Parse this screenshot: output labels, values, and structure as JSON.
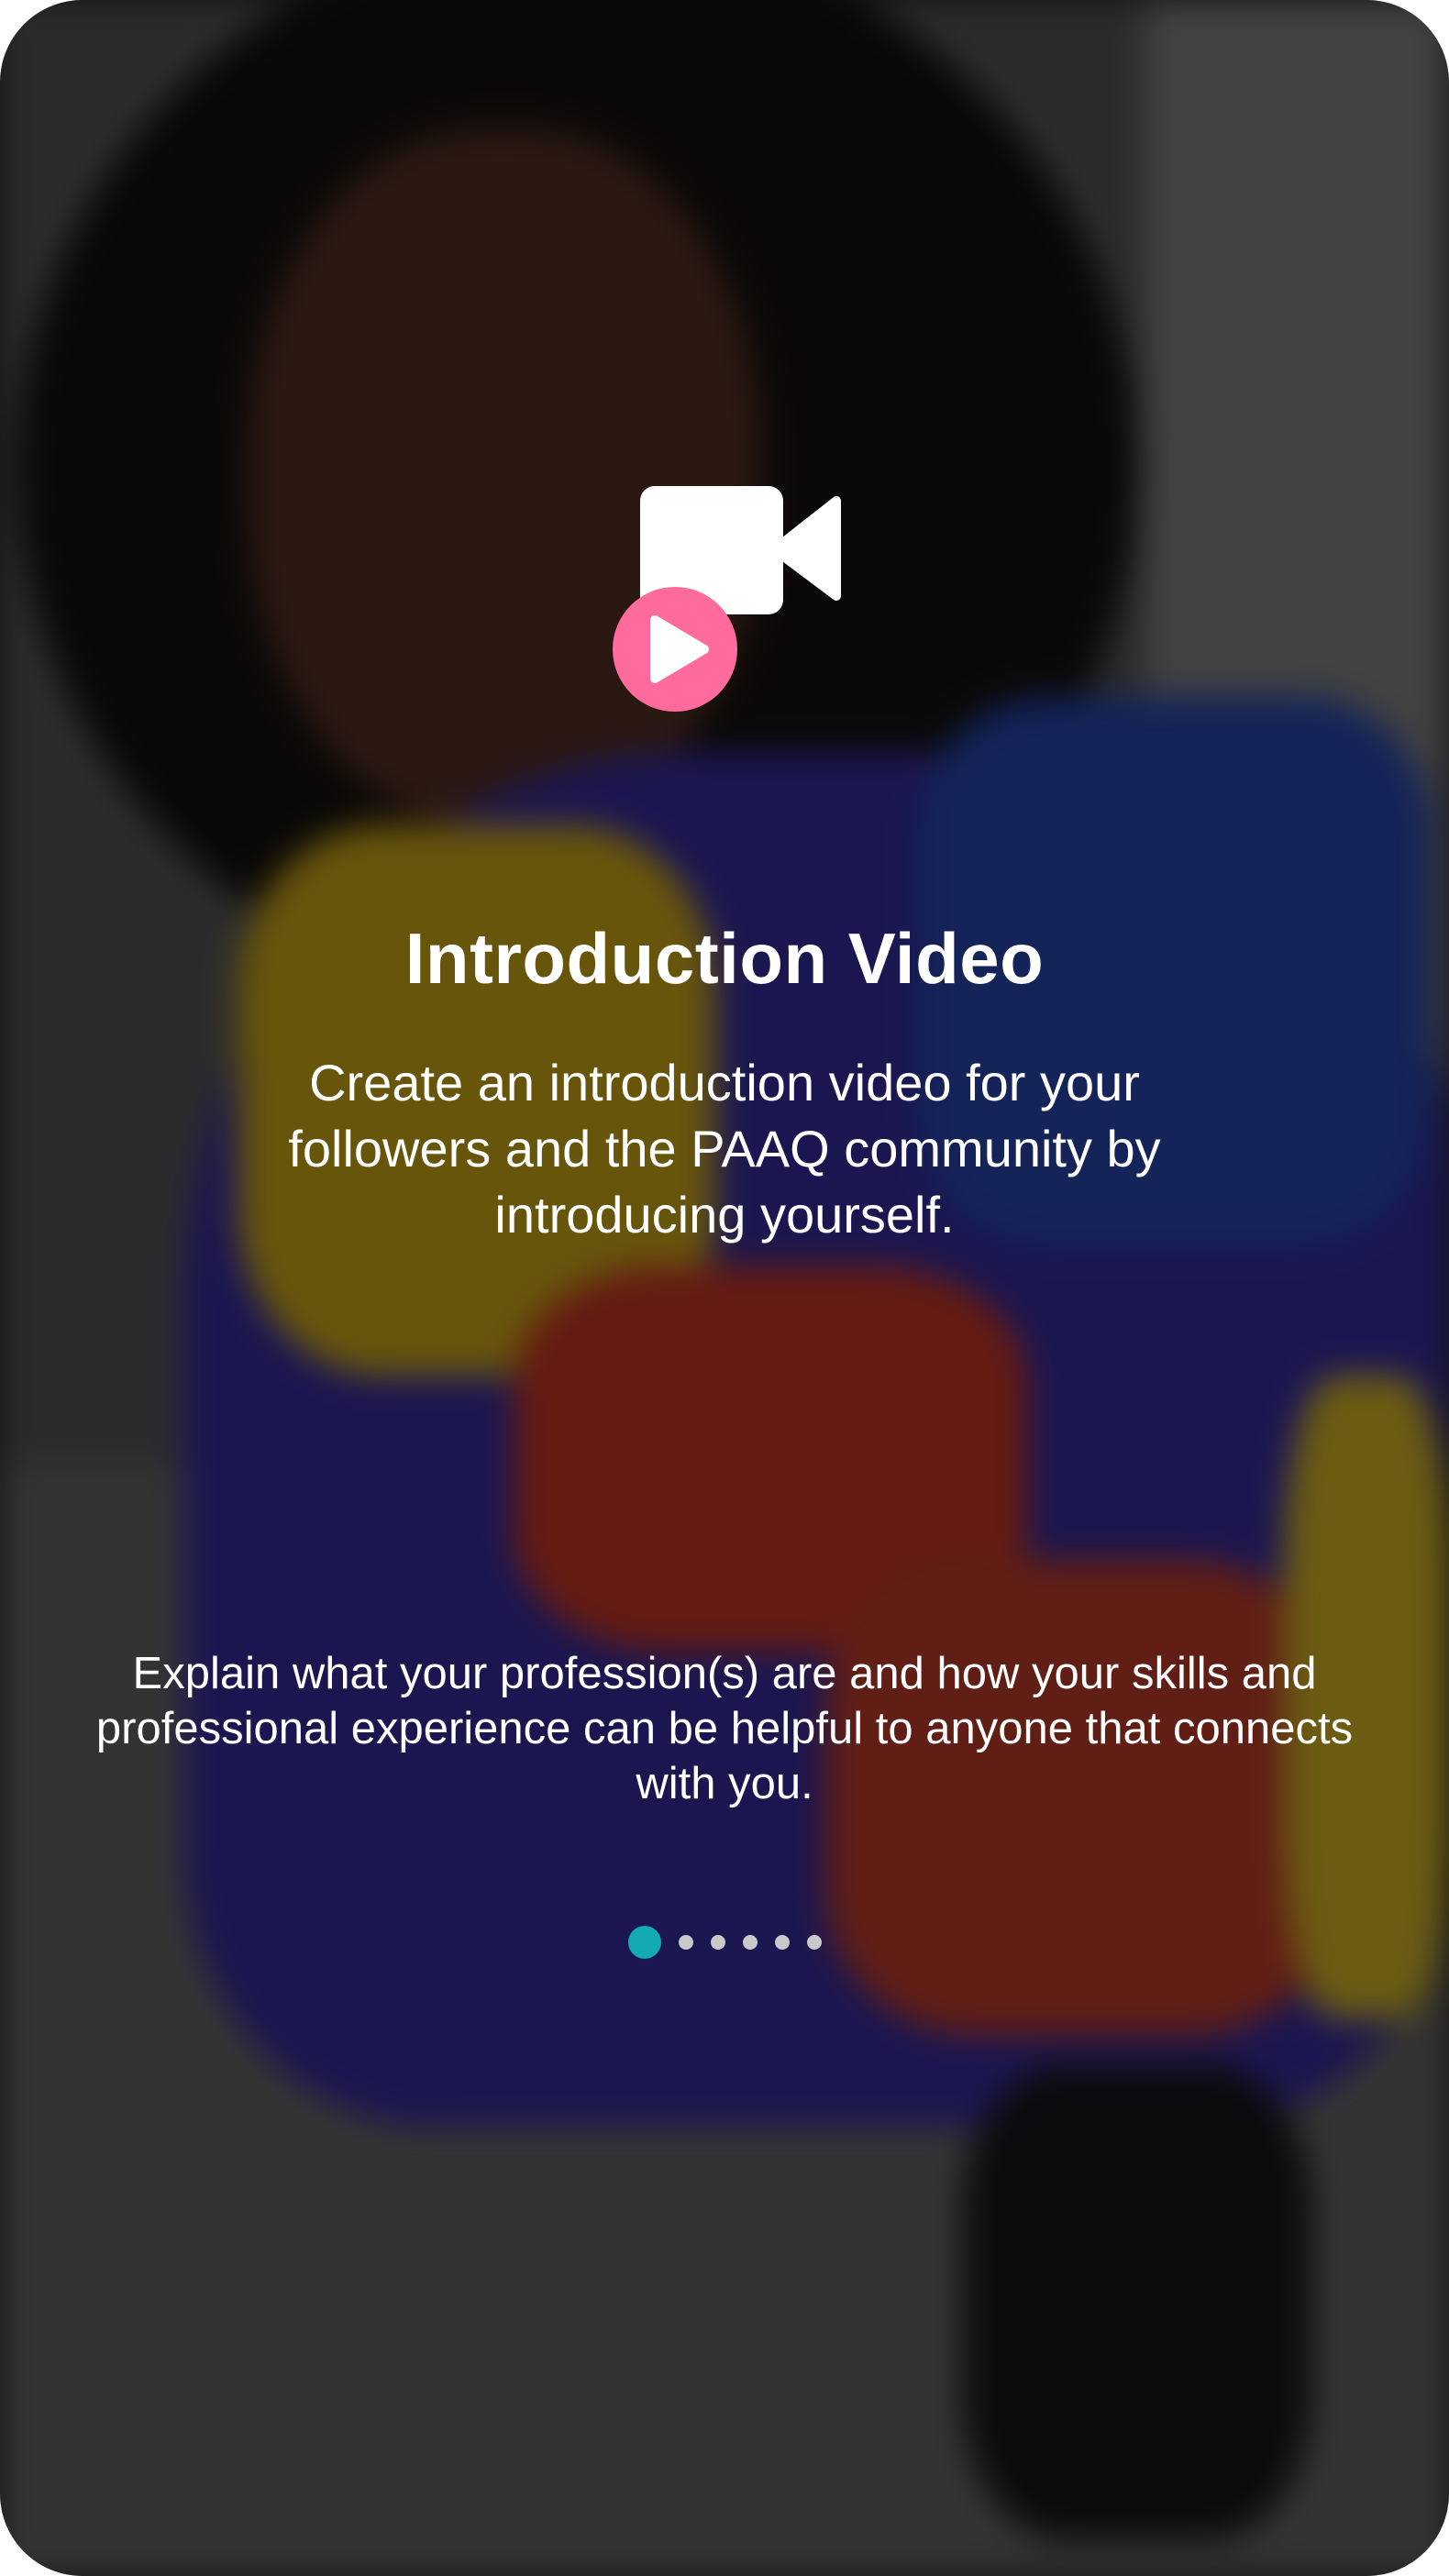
{
  "onboarding": {
    "title": "Introduction Video",
    "subtitle": "Create an introduction video for your followers and the PAAQ community by introducing yourself.",
    "description": "Explain what your profession(s) are and how your skills and professional experience can be helpful to anyone that connects with you.",
    "hero_icon": "video-camera-play-icon",
    "background_image": "person-photo",
    "pager": {
      "total_pages": 6,
      "current_page": 1
    }
  },
  "colors": {
    "accent_play": "#FF6B9D",
    "pager_active": "#14AAB4",
    "pager_inactive": "#C9C9C9",
    "text": "#FFFFFF",
    "overlay": "rgba(0,0,0,0.52)"
  }
}
